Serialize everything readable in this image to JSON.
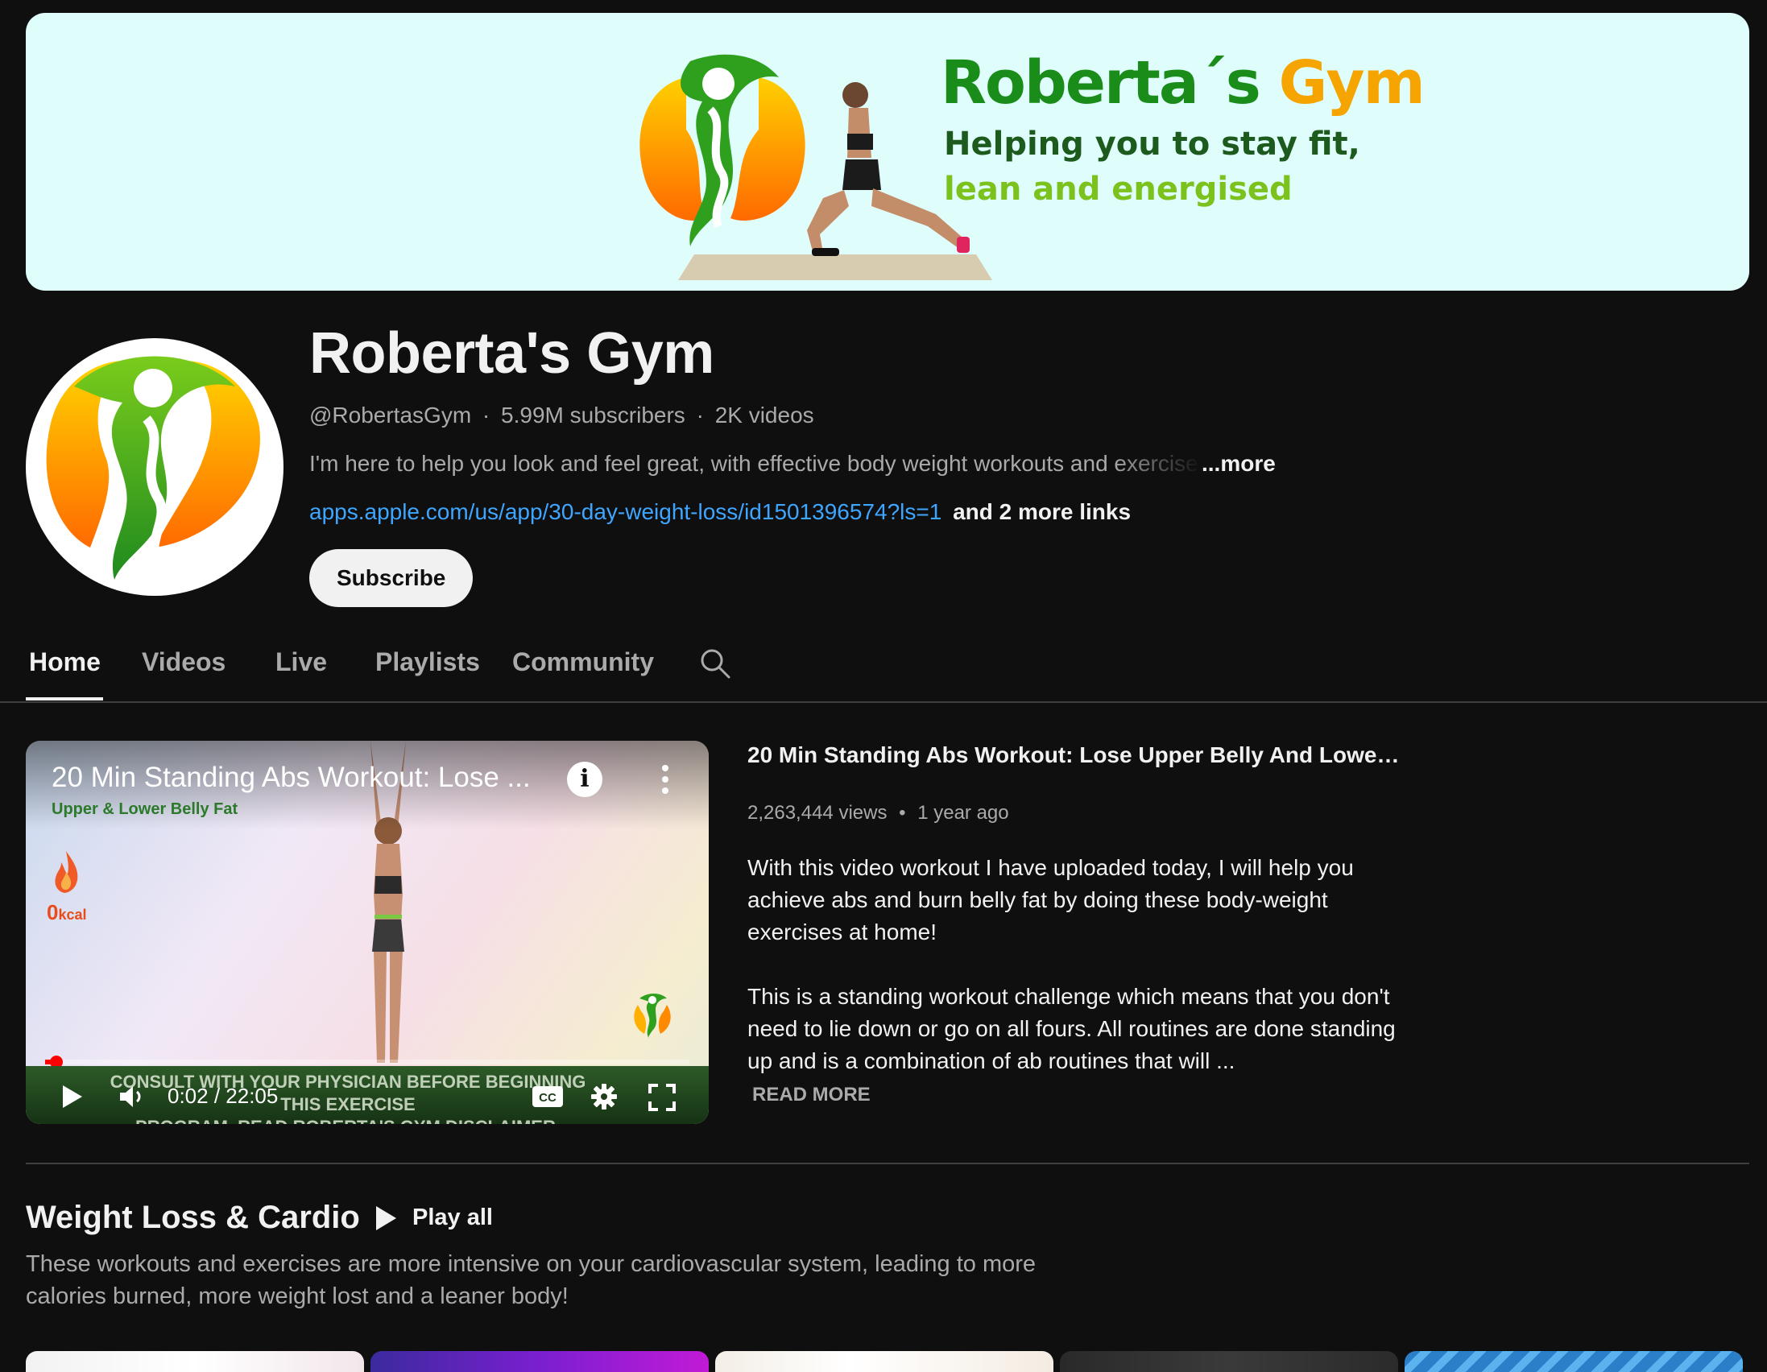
{
  "banner": {
    "brand_part1": "Roberta´s",
    "brand_part2": "Gym",
    "tagline_line1": "Helping you to stay fit,",
    "tagline_line2": "lean and energised",
    "colors": {
      "background": "#dffdfb",
      "brand_green": "#1a8c1a",
      "brand_orange": "#f6a400"
    }
  },
  "channel": {
    "name": "Roberta's Gym",
    "handle": "@RobertasGym",
    "subscribers": "5.99M subscribers",
    "videos": "2K videos",
    "meta_separator": "·",
    "description": "I'm here to help you look and feel great, with effective body weight workouts and exercises",
    "more_label": "...more",
    "link": "apps.apple.com/us/app/30-day-weight-loss/id1501396574?ls=1",
    "more_links": "and 2 more links",
    "subscribe_label": "Subscribe"
  },
  "tabs": {
    "items": [
      {
        "label": "Home",
        "active": true
      },
      {
        "label": "Videos",
        "active": false
      },
      {
        "label": "Live",
        "active": false
      },
      {
        "label": "Playlists",
        "active": false
      },
      {
        "label": "Community",
        "active": false
      }
    ],
    "search_icon": "search-icon"
  },
  "featured": {
    "player": {
      "title": "20 Min Standing Abs Workout: Lose ...",
      "subtitle": "Upper & Lower Belly Fat",
      "kcal_value": "0",
      "kcal_unit": "kcal",
      "disclaimer_line1": "CONSULT WITH YOUR PHYSICIAN BEFORE BEGINNING THIS EXERCISE",
      "disclaimer_line2": "PROGRAM. READ ROBERTA'S GYM DISCLAIMER.",
      "current_time": "0:02",
      "duration": "22:05",
      "time_display": "0:02 / 22:05",
      "progress_fraction": 0.0015,
      "cc_label": "CC",
      "icons": [
        "info-icon",
        "more-vert-icon",
        "play-icon",
        "volume-icon",
        "cc-icon",
        "settings-icon",
        "fullscreen-icon"
      ]
    },
    "title": "20 Min Standing Abs Workout: Lose Upper Belly And Lower Be...",
    "views": "2,263,444 views",
    "age": "1 year ago",
    "meta_separator": "•",
    "description_p1": "With this video workout I have uploaded today, I will help you achieve abs and burn belly fat by doing these body-weight exercises at home!",
    "description_p2": "This is a standing workout challenge which means that you don't need to lie down or go on all fours. All routines are done standing up and is a combination of ab routines that will ...",
    "read_more": "READ MORE"
  },
  "shelf": {
    "title": "Weight Loss & Cardio",
    "play_all": "Play all",
    "description": "These workouts and exercises are more intensive on your cardiovascular system, leading to more calories burned, more weight lost and a leaner body!"
  }
}
